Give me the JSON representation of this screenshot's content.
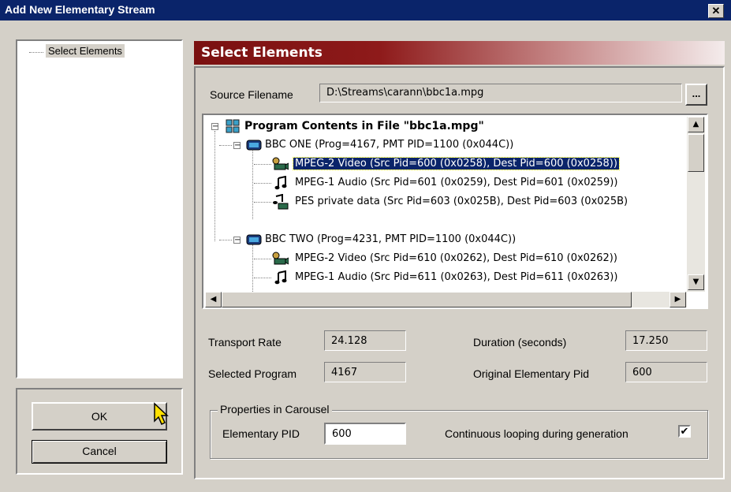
{
  "window": {
    "title": "Add New Elementary Stream",
    "close_glyph": "✕"
  },
  "nav_tree": {
    "items": [
      {
        "label": "Select Elements"
      }
    ]
  },
  "buttons": {
    "ok": "OK",
    "cancel": "Cancel"
  },
  "header": {
    "title": "Select Elements"
  },
  "source": {
    "label": "Source Filename",
    "value": "D:\\Streams\\carann\\bbc1a.mpg",
    "browse_label": "..."
  },
  "program_tree": {
    "root": {
      "label": "Program Contents in File \"bbc1a.mpg\"",
      "icon": "program-grid-icon"
    },
    "rows": [
      {
        "label": "BBC ONE (Prog=4167, PMT PID=1100 (0x044C))",
        "icon": "tv-icon"
      },
      {
        "label": "MPEG-2 Video (Src Pid=600 (0x0258), Dest Pid=600 (0x0258))",
        "icon": "video-camera-icon",
        "selected": true
      },
      {
        "label": "MPEG-1 Audio (Src Pid=601 (0x0259), Dest Pid=601 (0x0259))",
        "icon": "music-note-icon"
      },
      {
        "label": "PES private data (Src Pid=603 (0x025B), Dest Pid=603 (0x025B)",
        "icon": "data-icon"
      },
      {
        "label": "BBC TWO (Prog=4231, PMT PID=1100 (0x044C))",
        "icon": "tv-icon"
      },
      {
        "label": "MPEG-2 Video (Src Pid=610 (0x0262), Dest Pid=610 (0x0262))",
        "icon": "video-camera-icon"
      },
      {
        "label": "MPEG-1 Audio (Src Pid=611 (0x0263), Dest Pid=611 (0x0263))",
        "icon": "music-note-icon"
      }
    ]
  },
  "info": {
    "transport_rate": {
      "label": "Transport Rate",
      "value": "24.128"
    },
    "duration": {
      "label": "Duration (seconds)",
      "value": "17.250"
    },
    "selected_program": {
      "label": "Selected Program",
      "value": "4167"
    },
    "original_pid": {
      "label": "Original Elementary Pid",
      "value": "600"
    }
  },
  "carousel": {
    "group_label": "Properties in Carousel",
    "pid_label": "Elementary PID",
    "pid_value": "600",
    "looping_label": "Continuous looping during generation",
    "looping_checked": true,
    "check_glyph": "✔"
  },
  "colors": {
    "titlebar": "#0a246a",
    "header": "#8e1a1a",
    "face": "#d4d0c8",
    "selection": "#0a246a"
  }
}
